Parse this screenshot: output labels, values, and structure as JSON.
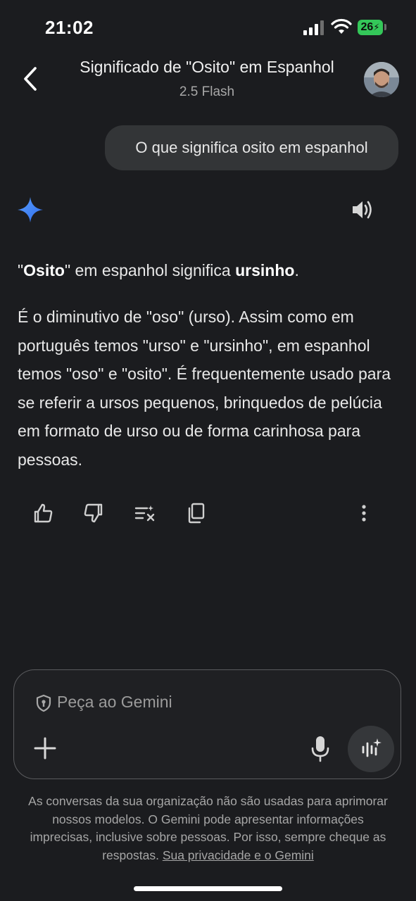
{
  "status_bar": {
    "time": "21:02",
    "battery": "26",
    "battery_color": "#34c759",
    "icons": [
      "signal-icon",
      "wifi-icon",
      "battery-charging-icon"
    ]
  },
  "header": {
    "title": "Significado de \"Osito\" em Espanhol",
    "model": "2.5 Flash",
    "back_icon": "chevron-left-icon"
  },
  "user_message": "O que significa osito em espanhol",
  "response": {
    "p1": {
      "q1": "\"",
      "bold1": "Osito",
      "t1": "\" em espanhol significa ",
      "bold2": "ursinho",
      "t2": "."
    },
    "p2": "É o diminutivo de \"oso\" (urso). Assim como em português temos \"urso\" e \"ursinho\", em espanhol temos \"oso\" e \"osito\". É frequentemente usado para se referir a ursos pequenos, brinquedos de pelúcia em formato de urso ou de forma carinhosa para pessoas.",
    "actions": [
      "thumbs-up-icon",
      "thumbs-down-icon",
      "modify-response-icon",
      "copy-icon",
      "more-options-icon"
    ]
  },
  "input": {
    "placeholder": "Peça ao Gemini"
  },
  "disclaimer": {
    "text": "As conversas da sua organização não são usadas para aprimorar nossos modelos. O Gemini pode apresentar informações imprecisas, inclusive sobre pessoas. Por isso, sempre cheque as respostas. ",
    "link": "Sua privacidade e o Gemini"
  },
  "colors": {
    "background": "#1b1c1f",
    "bubble": "#333537",
    "gemini_blue": "#4a8cff"
  }
}
